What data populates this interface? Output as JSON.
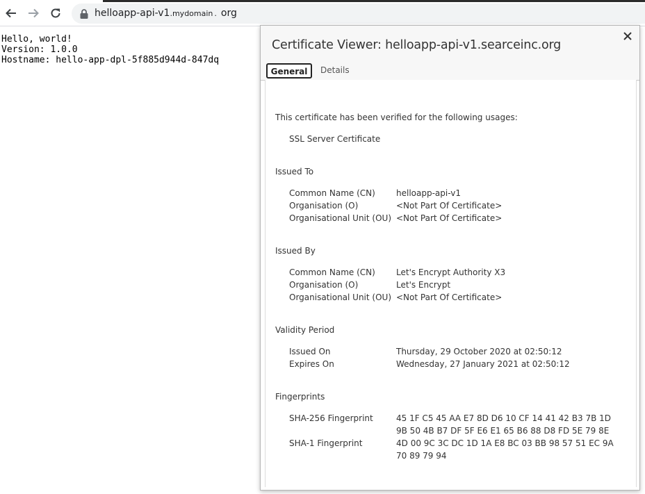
{
  "browser": {
    "nav": {
      "back_icon": "arrow-left-icon",
      "forward_icon": "arrow-right-icon",
      "reload_icon": "reload-icon"
    },
    "address_bar": {
      "lock_icon": "lock-icon",
      "url_host": "helloapp-api-v1",
      "url_domain": ".mydomain",
      "url_dot": ".",
      "url_tld": "org"
    }
  },
  "page": {
    "lines": [
      "Hello, world!",
      "Version: 1.0.0",
      "Hostname: hello-app-dpl-5f885d944d-847dq"
    ]
  },
  "certificate_viewer": {
    "title": "Certificate Viewer: helloapp-api-v1.searceinc.org",
    "close_icon": "close-icon",
    "tabs": [
      "General",
      "Details"
    ],
    "active_tab": "General",
    "verified_heading": "This certificate has been verified for the following usages:",
    "usages": [
      "SSL Server Certificate"
    ],
    "issued_to": {
      "heading": "Issued To",
      "rows": [
        {
          "label": "Common Name (CN)",
          "value": "helloapp-api-v1"
        },
        {
          "label": "Organisation (O)",
          "value": "<Not Part Of Certificate>"
        },
        {
          "label": "Organisational Unit (OU)",
          "value": "<Not Part Of Certificate>"
        }
      ]
    },
    "issued_by": {
      "heading": "Issued By",
      "rows": [
        {
          "label": "Common Name (CN)",
          "value": "Let's Encrypt Authority X3"
        },
        {
          "label": "Organisation (O)",
          "value": "Let's Encrypt"
        },
        {
          "label": "Organisational Unit (OU)",
          "value": "<Not Part Of Certificate>"
        }
      ]
    },
    "validity": {
      "heading": "Validity Period",
      "rows": [
        {
          "label": "Issued On",
          "value": "Thursday, 29 October 2020 at 02:50:12"
        },
        {
          "label": "Expires On",
          "value": "Wednesday, 27 January 2021 at 02:50:12"
        }
      ]
    },
    "fingerprints": {
      "heading": "Fingerprints",
      "rows": [
        {
          "label": "SHA-256 Fingerprint",
          "value_lines": [
            "45 1F C5 45 AA E7 8D D6 10 CF 14 41 42 B3 7B 1D",
            "9B 50 4B B7 DF 5F E6 E1 65 B6 88 D8 FD 5E 79 8E"
          ]
        },
        {
          "label": "SHA-1 Fingerprint",
          "value_lines": [
            "4D 00 9C 3C DC 1D 1A E8 BC 03 BB 98 57 51 EC 9A",
            "70 89 79 94"
          ]
        }
      ]
    }
  }
}
